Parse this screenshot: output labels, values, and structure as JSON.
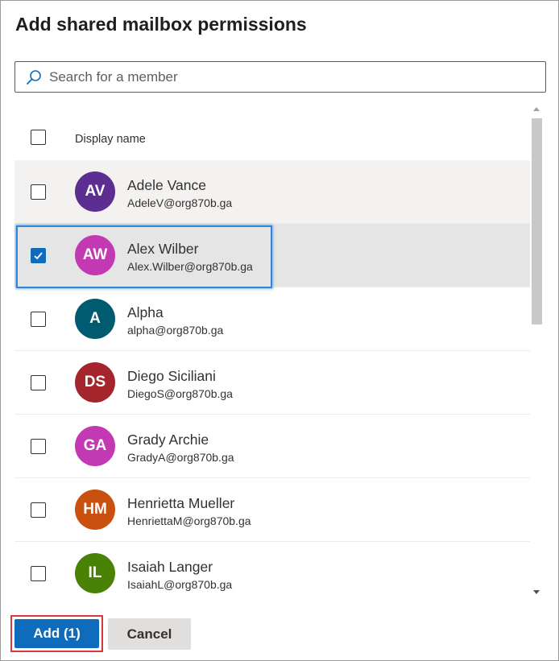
{
  "dialog": {
    "title": "Add shared mailbox permissions",
    "search": {
      "placeholder": "Search for a member",
      "value": ""
    },
    "list": {
      "column_header": "Display name",
      "members": [
        {
          "initials": "AV",
          "name": "Adele Vance",
          "email": "AdeleV@org870b.ga",
          "color": "#5c2e91",
          "checked": false
        },
        {
          "initials": "AW",
          "name": "Alex Wilber",
          "email": "Alex.Wilber@org870b.ga",
          "color": "#c239b3",
          "checked": true
        },
        {
          "initials": "A",
          "name": "Alpha",
          "email": "alpha@org870b.ga",
          "color": "#005b70",
          "checked": false
        },
        {
          "initials": "DS",
          "name": "Diego Siciliani",
          "email": "DiegoS@org870b.ga",
          "color": "#a4262c",
          "checked": false
        },
        {
          "initials": "GA",
          "name": "Grady Archie",
          "email": "GradyA@org870b.ga",
          "color": "#c239b3",
          "checked": false
        },
        {
          "initials": "HM",
          "name": "Henrietta Mueller",
          "email": "HenriettaM@org870b.ga",
          "color": "#ca5010",
          "checked": false
        },
        {
          "initials": "IL",
          "name": "Isaiah Langer",
          "email": "IsaiahL@org870b.ga",
          "color": "#498205",
          "checked": false
        }
      ]
    },
    "buttons": {
      "add_label": "Add (1)",
      "cancel_label": "Cancel"
    },
    "colors": {
      "accent": "#0f6cbd",
      "selection_outline": "#2f86d8",
      "add_outline": "#d9363e"
    }
  }
}
